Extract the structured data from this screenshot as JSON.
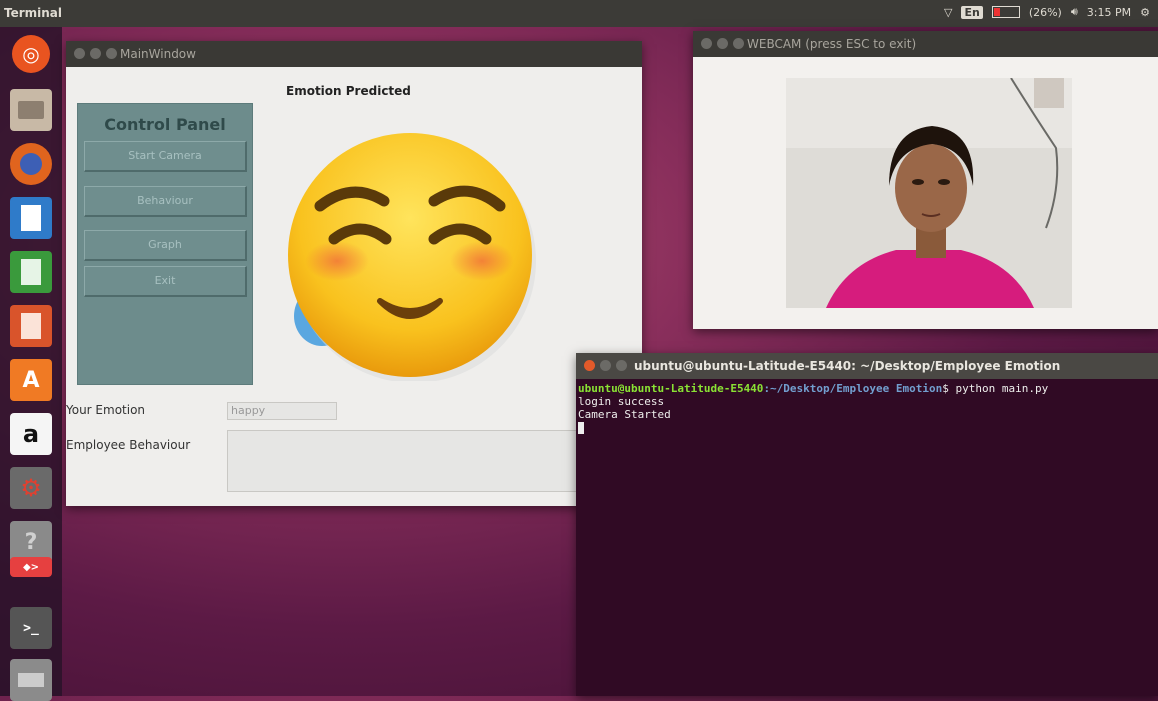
{
  "topbar": {
    "app_title": "Terminal",
    "battery": "(26%)",
    "keyboard": "En",
    "clock": "3:15 PM"
  },
  "launcher": {
    "items": [
      "ubuntu-dash-icon",
      "files-icon",
      "firefox-icon",
      "writer-icon",
      "calc-icon",
      "impress-icon",
      "software-center-icon",
      "amazon-icon",
      "settings-icon",
      "help-icon",
      "remote-icon",
      "terminal-icon",
      "dvd-icon"
    ]
  },
  "main_window": {
    "title": "MainWindow",
    "control_panel_title": "Control Panel",
    "buttons": [
      "Start Camera",
      "Behaviour",
      "Graph",
      "Exit"
    ],
    "emotion_predicted_label": "Emotion Predicted",
    "your_emotion_label": "Your Emotion",
    "your_emotion_value": "happy",
    "employee_behaviour_label": "Employee Behaviour",
    "employee_behaviour_value": ""
  },
  "webcam_window": {
    "title": "WEBCAM (press ESC to exit)"
  },
  "terminal": {
    "title": "ubuntu@ubuntu-Latitude-E5440: ~/Desktop/Employee Emotion",
    "prompt_user": "ubuntu@ubuntu-Latitude-E5440",
    "prompt_path": ":~/Desktop/Employee Emotion",
    "command": "$ python main.py",
    "lines": [
      "login success",
      "Camera Started"
    ]
  },
  "colors": {
    "panel": "#6d8c8c",
    "terminal_bg": "#300a24",
    "prompt_green": "#8ae234",
    "path_blue": "#729fcf",
    "shirt_pink": "#d61c7d"
  }
}
